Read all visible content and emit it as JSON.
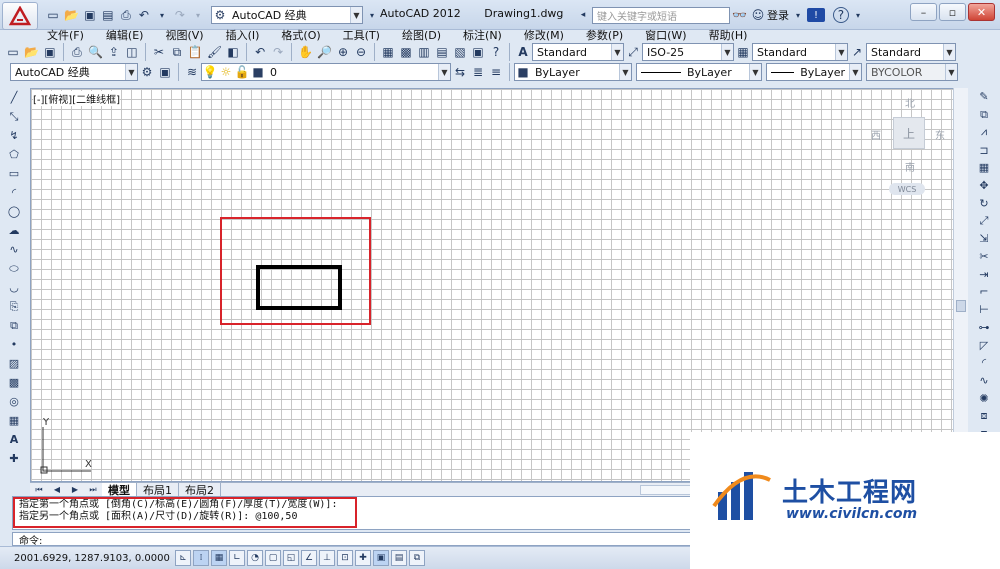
{
  "window": {
    "title": "AutoCAD 2012",
    "document": "Drawing1.dwg"
  },
  "quick_access": {
    "workspace": "AutoCAD 经典"
  },
  "search": {
    "placeholder": "键入关键字或短语"
  },
  "user": {
    "login_label": "登录"
  },
  "menu": {
    "items": [
      "文件(F)",
      "编辑(E)",
      "视图(V)",
      "插入(I)",
      "格式(O)",
      "工具(T)",
      "绘图(D)",
      "标注(N)",
      "修改(M)",
      "参数(P)",
      "窗口(W)",
      "帮助(H)"
    ]
  },
  "styles": {
    "text_style": "Standard",
    "dim_style": "ISO-25",
    "table_style": "Standard",
    "mleader_style": "Standard"
  },
  "layers": {
    "workspace": "AutoCAD 经典",
    "current_layer": "0",
    "color": "ByLayer",
    "linetype": "ByLayer",
    "lineweight": "ByLayer",
    "plotstyle": "BYCOLOR"
  },
  "viewport": {
    "label": "[-][俯视][二维线框]"
  },
  "viewcube": {
    "north": "北",
    "south": "南",
    "east": "东",
    "west": "西",
    "top": "上",
    "wcs": "WCS"
  },
  "ucs": {
    "x": "X",
    "y": "Y"
  },
  "layout_tabs": [
    "模型",
    "布局1",
    "布局2"
  ],
  "command": {
    "lines": [
      "指定第一个角点或 [倒角(C)/标高(E)/圆角(F)/厚度(T)/宽度(W)]:",
      "指定另一个角点或 [面积(A)/尺寸(D)/旋转(R)]: @100,50"
    ],
    "prompt": "命令:"
  },
  "status": {
    "coords": "2001.6929, 1287.9103, 0.0000"
  },
  "watermark": {
    "brand": "土木工程网",
    "url": "www.civilcn.com"
  },
  "colors": {
    "accent_red": "#d8232a",
    "watermark_blue": "#1e4fa3",
    "grid": "#c6c6c6"
  }
}
